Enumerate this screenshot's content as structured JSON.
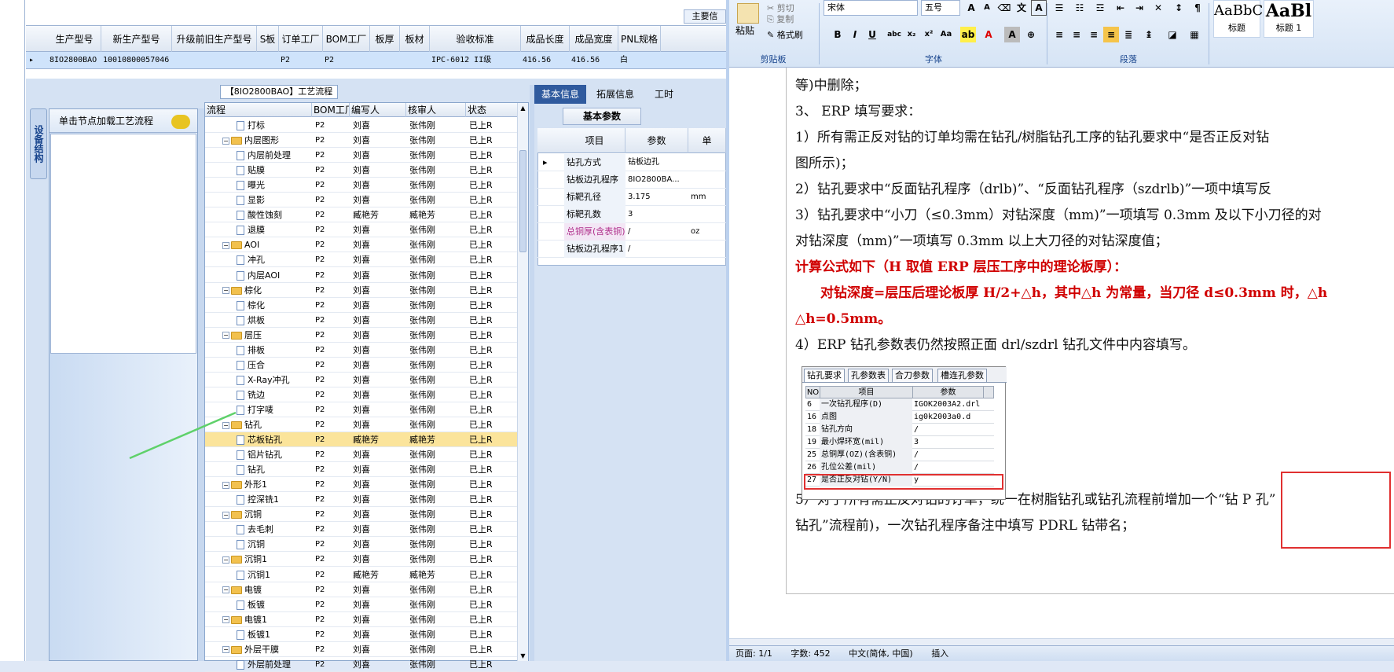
{
  "top_grid": {
    "headers": [
      "生产型号",
      "新生产型号",
      "升级前旧生产型号",
      "S板",
      "订单工厂",
      "BOM工厂",
      "板厚",
      "板材",
      "验收标准",
      "成品长度",
      "成品宽度",
      "PNL规格"
    ],
    "row": [
      "8IO2800BAO",
      "10010800057046",
      "",
      "",
      "P2",
      "P2",
      "",
      "",
      "IPC-6012 II级",
      "416.56",
      "416.56",
      "白"
    ],
    "main_info_label": "主要信"
  },
  "device_panel": {
    "vtab_label": "设备结构",
    "header": "单击节点加载工艺流程"
  },
  "process_panel": {
    "title": "【8IO2800BAO】工艺流程",
    "headers": [
      "流程",
      "BOM工厂",
      "编写人",
      "核审人",
      "状态"
    ],
    "rows": [
      {
        "level": 2,
        "type": "doc",
        "name": "打标",
        "bom": "P2",
        "writer": "刘喜",
        "reviewer": "张伟刚",
        "status": "已上R"
      },
      {
        "level": 1,
        "type": "folder",
        "name": "内层图形",
        "bom": "P2",
        "writer": "刘喜",
        "reviewer": "张伟刚",
        "status": "已上R"
      },
      {
        "level": 2,
        "type": "doc",
        "name": "内层前处理",
        "bom": "P2",
        "writer": "刘喜",
        "reviewer": "张伟刚",
        "status": "已上R"
      },
      {
        "level": 2,
        "type": "doc",
        "name": "贴膜",
        "bom": "P2",
        "writer": "刘喜",
        "reviewer": "张伟刚",
        "status": "已上R"
      },
      {
        "level": 2,
        "type": "doc",
        "name": "曝光",
        "bom": "P2",
        "writer": "刘喜",
        "reviewer": "张伟刚",
        "status": "已上R"
      },
      {
        "level": 2,
        "type": "doc",
        "name": "显影",
        "bom": "P2",
        "writer": "刘喜",
        "reviewer": "张伟刚",
        "status": "已上R"
      },
      {
        "level": 2,
        "type": "doc",
        "name": "酸性蚀刻",
        "bom": "P2",
        "writer": "臧艳芳",
        "reviewer": "臧艳芳",
        "status": "已上R"
      },
      {
        "level": 2,
        "type": "doc",
        "name": "退膜",
        "bom": "P2",
        "writer": "刘喜",
        "reviewer": "张伟刚",
        "status": "已上R"
      },
      {
        "level": 1,
        "type": "folder",
        "name": "AOI",
        "bom": "P2",
        "writer": "刘喜",
        "reviewer": "张伟刚",
        "status": "已上R"
      },
      {
        "level": 2,
        "type": "doc",
        "name": "冲孔",
        "bom": "P2",
        "writer": "刘喜",
        "reviewer": "张伟刚",
        "status": "已上R"
      },
      {
        "level": 2,
        "type": "doc",
        "name": "内层AOI",
        "bom": "P2",
        "writer": "刘喜",
        "reviewer": "张伟刚",
        "status": "已上R"
      },
      {
        "level": 1,
        "type": "folder",
        "name": "棕化",
        "bom": "P2",
        "writer": "刘喜",
        "reviewer": "张伟刚",
        "status": "已上R"
      },
      {
        "level": 2,
        "type": "doc",
        "name": "棕化",
        "bom": "P2",
        "writer": "刘喜",
        "reviewer": "张伟刚",
        "status": "已上R"
      },
      {
        "level": 2,
        "type": "doc",
        "name": "烘板",
        "bom": "P2",
        "writer": "刘喜",
        "reviewer": "张伟刚",
        "status": "已上R"
      },
      {
        "level": 1,
        "type": "folder",
        "name": "层压",
        "bom": "P2",
        "writer": "刘喜",
        "reviewer": "张伟刚",
        "status": "已上R"
      },
      {
        "level": 2,
        "type": "doc",
        "name": "排板",
        "bom": "P2",
        "writer": "刘喜",
        "reviewer": "张伟刚",
        "status": "已上R"
      },
      {
        "level": 2,
        "type": "doc",
        "name": "压合",
        "bom": "P2",
        "writer": "刘喜",
        "reviewer": "张伟刚",
        "status": "已上R"
      },
      {
        "level": 2,
        "type": "doc",
        "name": "X-Ray冲孔",
        "bom": "P2",
        "writer": "刘喜",
        "reviewer": "张伟刚",
        "status": "已上R"
      },
      {
        "level": 2,
        "type": "doc",
        "name": "铣边",
        "bom": "P2",
        "writer": "刘喜",
        "reviewer": "张伟刚",
        "status": "已上R"
      },
      {
        "level": 2,
        "type": "doc",
        "name": "打字唛",
        "bom": "P2",
        "writer": "刘喜",
        "reviewer": "张伟刚",
        "status": "已上R"
      },
      {
        "level": 1,
        "type": "folder",
        "name": "钻孔",
        "bom": "P2",
        "writer": "刘喜",
        "reviewer": "张伟刚",
        "status": "已上R"
      },
      {
        "level": 2,
        "type": "doc",
        "name": "芯板钻孔",
        "bom": "P2",
        "writer": "臧艳芳",
        "reviewer": "臧艳芳",
        "status": "已上R",
        "selected": true
      },
      {
        "level": 2,
        "type": "doc",
        "name": "铝片钻孔",
        "bom": "P2",
        "writer": "刘喜",
        "reviewer": "张伟刚",
        "status": "已上R"
      },
      {
        "level": 2,
        "type": "doc",
        "name": "钻孔",
        "bom": "P2",
        "writer": "刘喜",
        "reviewer": "张伟刚",
        "status": "已上R"
      },
      {
        "level": 1,
        "type": "folder",
        "name": "外形1",
        "bom": "P2",
        "writer": "刘喜",
        "reviewer": "张伟刚",
        "status": "已上R"
      },
      {
        "level": 2,
        "type": "doc",
        "name": "控深铣1",
        "bom": "P2",
        "writer": "刘喜",
        "reviewer": "张伟刚",
        "status": "已上R"
      },
      {
        "level": 1,
        "type": "folder",
        "name": "沉铜",
        "bom": "P2",
        "writer": "刘喜",
        "reviewer": "张伟刚",
        "status": "已上R"
      },
      {
        "level": 2,
        "type": "doc",
        "name": "去毛刺",
        "bom": "P2",
        "writer": "刘喜",
        "reviewer": "张伟刚",
        "status": "已上R"
      },
      {
        "level": 2,
        "type": "doc",
        "name": "沉铜",
        "bom": "P2",
        "writer": "刘喜",
        "reviewer": "张伟刚",
        "status": "已上R"
      },
      {
        "level": 1,
        "type": "folder",
        "name": "沉铜1",
        "bom": "P2",
        "writer": "刘喜",
        "reviewer": "张伟刚",
        "status": "已上R"
      },
      {
        "level": 2,
        "type": "doc",
        "name": "沉铜1",
        "bom": "P2",
        "writer": "臧艳芳",
        "reviewer": "臧艳芳",
        "status": "已上R"
      },
      {
        "level": 1,
        "type": "folder",
        "name": "电镀",
        "bom": "P2",
        "writer": "刘喜",
        "reviewer": "张伟刚",
        "status": "已上R"
      },
      {
        "level": 2,
        "type": "doc",
        "name": "板镀",
        "bom": "P2",
        "writer": "刘喜",
        "reviewer": "张伟刚",
        "status": "已上R"
      },
      {
        "level": 1,
        "type": "folder",
        "name": "电镀1",
        "bom": "P2",
        "writer": "刘喜",
        "reviewer": "张伟刚",
        "status": "已上R"
      },
      {
        "level": 2,
        "type": "doc",
        "name": "板镀1",
        "bom": "P2",
        "writer": "刘喜",
        "reviewer": "张伟刚",
        "status": "已上R"
      },
      {
        "level": 1,
        "type": "folder",
        "name": "外层干膜",
        "bom": "P2",
        "writer": "刘喜",
        "reviewer": "张伟刚",
        "status": "已上R"
      },
      {
        "level": 2,
        "type": "doc",
        "name": "外层前处理",
        "bom": "P2",
        "writer": "刘喜",
        "reviewer": "张伟刚",
        "status": "已上R"
      }
    ]
  },
  "info_panel": {
    "tabs": [
      "基本信息",
      "拓展信息",
      "工时"
    ],
    "subtab": "基本参数",
    "headers": [
      "项目",
      "参数",
      "单"
    ],
    "rows": [
      {
        "item": "钻孔方式",
        "value": "钻板边孔",
        "unit": ""
      },
      {
        "item": "钻板边孔程序",
        "value": "8IO2800BA...",
        "unit": ""
      },
      {
        "item": "标靶孔径",
        "value": "3.175",
        "unit": "mm"
      },
      {
        "item": "标靶孔数",
        "value": "3",
        "unit": ""
      },
      {
        "item": "总铜厚(含表铜)",
        "value": "/",
        "unit": "oz",
        "highlight": true
      },
      {
        "item": "钻板边孔程序1",
        "value": "/",
        "unit": ""
      }
    ]
  },
  "word": {
    "clipboard": {
      "paste": "粘贴",
      "cut": "剪切",
      "copy": "复制",
      "format_painter": "格式刷",
      "label": "剪贴板"
    },
    "font": {
      "name": "宋体",
      "size": "五号",
      "label": "字体"
    },
    "paragraph_label": "段落",
    "styles": [
      {
        "preview": "AaBbC",
        "name": "标题"
      },
      {
        "preview": "AaBl",
        "name": "标题 1"
      }
    ],
    "lines": [
      "等)中删除；",
      "3、 ERP 填写要求：",
      "1）所有需正反对钻的订单均需在钻孔/树脂钻孔工序的钻孔要求中“是否正反对钻",
      "图所示)；",
      "2）钻孔要求中“反面钻孔程序（drlb)”、“反面钻孔程序（szdrlb)”一项中填写反",
      "3）钻孔要求中“小刀（≤0.3mm）对钻深度（mm)”一项填写 0.3mm 及以下小刀径的对",
      "对钻深度（mm)”一项填写 0.3mm 以上大刀径的对钻深度值；",
      "计算公式如下（H 取值 ERP 层压工序中的理论板厚）：",
      "对钻深度=层压后理论板厚 H/2+△h，其中△h 为常量，当刀径 d≤0.3mm 时，△h",
      "△h=0.5mm。",
      "4）ERP 钻孔参数表仍然按照正面 drl/szdrl 钻孔文件中内容填写。",
      "5）对于所有需正反对钻的订单，统一在树脂钻孔或钻孔流程前增加一个“钻 P 孔”",
      "钻孔”流程前)，一次钻孔程序备注中填写 PDRL 钻带名；"
    ],
    "embed": {
      "tabs": [
        "钻孔要求",
        "孔参数表",
        "合刀参数",
        "槽连孔参数"
      ],
      "headers": [
        "NO",
        "项目",
        "参数"
      ],
      "rows": [
        [
          "6",
          "一次钻孔程序(D)",
          "IGOK2003A2.drl"
        ],
        [
          "16",
          "点图",
          "ig0k2003a0.d"
        ],
        [
          "18",
          "钻孔方向",
          "/"
        ],
        [
          "19",
          "最小焊环宽(mil)",
          "3"
        ],
        [
          "25",
          "总铜厚(OZ)(含表铜)",
          "/"
        ],
        [
          "26",
          "孔位公差(mil)",
          "/"
        ],
        [
          "27",
          "是否正反对钻(Y/N)",
          "y"
        ]
      ]
    },
    "status": {
      "page": "页面: 1/1",
      "words": "字数: 452",
      "lang": "中文(简体, 中国)",
      "mode": "插入"
    }
  },
  "colors": {
    "selection": "#fbe49b",
    "accent": "#2f5a9e",
    "red": "#d00000",
    "arrow": "#5fd16a"
  }
}
